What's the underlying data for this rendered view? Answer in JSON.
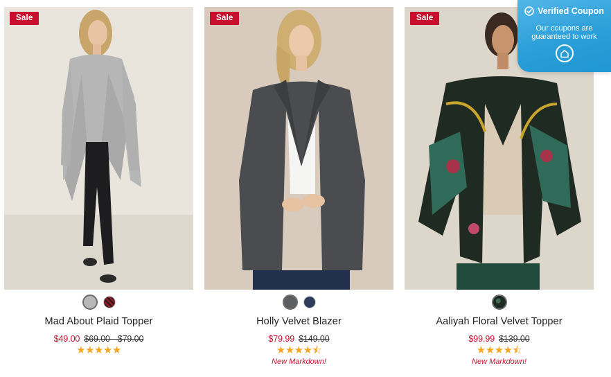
{
  "products": [
    {
      "badge": "Sale",
      "name": "Mad About Plaid Topper",
      "sale_price": "$49.00",
      "original_price": "$69.00 - $79.00",
      "rating_stars": "★★★★★",
      "rating": 5,
      "note": "",
      "swatch_colors": [
        "#b8b8b8",
        "#8b1a2b"
      ]
    },
    {
      "badge": "Sale",
      "name": "Holly Velvet Blazer",
      "sale_price": "$79.99",
      "original_price": "$149.00",
      "rating_stars": "★★★★⯪",
      "rating": 4.5,
      "note": "New Markdown!",
      "swatch_colors": [
        "#5b5d61",
        "#2f3c5a"
      ]
    },
    {
      "badge": "Sale",
      "name": "Aaliyah Floral Velvet Topper",
      "sale_price": "$99.99",
      "original_price": "$139.00",
      "rating_stars": "★★★★⯪",
      "rating": 4.5,
      "note": "New Markdown!",
      "swatch_colors": [
        "#1f2a22"
      ]
    }
  ],
  "coupon": {
    "title": "Verified Coupon",
    "message": "Our coupons are guaranteed to work",
    "check_icon": "check-circle-icon",
    "home_icon": "home-icon"
  },
  "colors": {
    "sale_red": "#c8102e",
    "star_gold": "#f5a623",
    "coupon_blue": "#2a9fd8"
  }
}
